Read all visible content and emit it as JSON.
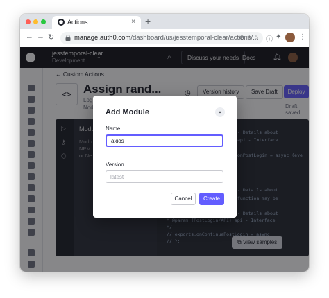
{
  "browser": {
    "tab_title": "Actions",
    "tab_close": "×",
    "new_tab": "+",
    "url_host": "manage.auth0.com",
    "url_path": "/dashboard/us/jesstemporal-clear/actions/...",
    "back": "←",
    "forward": "→",
    "reload": "↻"
  },
  "topnav": {
    "tenant_name": "jesstemporal-clear",
    "tenant_env": "Development",
    "discuss_label": "Discuss your needs",
    "docs_label": "Docs"
  },
  "page": {
    "breadcrumb": "← Custom Actions",
    "code_icon": "<>",
    "action_title": "Assign rand...",
    "action_sub1": "Log",
    "action_sub2": "Nod",
    "version_history_label": "Version history",
    "save_draft_label": "Save Draft",
    "deploy_label": "Deploy",
    "draft_status": "Draft saved"
  },
  "editor": {
    "panel_title": "Modu",
    "panel_lines": [
      "Modu",
      "NPM",
      "or Ne"
    ],
    "code_lines": [
      "- Details about",
      "api - Interface",
      "onPostLogin = async (eve",
      "",
      "- Details about",
      "function may be",
      "",
      "- Details about",
      "* @param {PostLogin/API} api - Interface",
      "*/",
      "// exports.onContinuePostLogin = async",
      "// };"
    ],
    "view_samples_label": "View samples"
  },
  "modal": {
    "title": "Add Module",
    "close": "×",
    "name_label": "Name",
    "name_value": "axios",
    "version_label": "Version",
    "version_placeholder": "latest",
    "cancel_label": "Cancel",
    "create_label": "Create"
  },
  "colors": {
    "accent": "#635dff",
    "topnav_bg": "#16171d",
    "editor_bg": "#262a33"
  }
}
